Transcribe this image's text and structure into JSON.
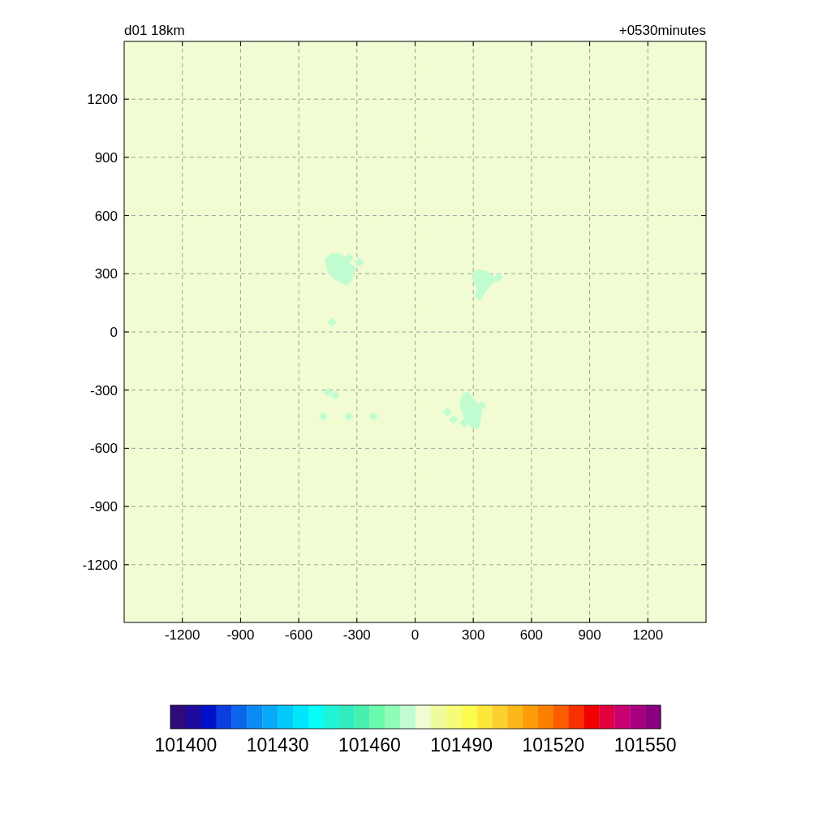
{
  "plot": {
    "title_left": "d01 18km",
    "title_right": "+0530minutes",
    "y_ticks": [
      "1200",
      "900",
      "600",
      "300",
      "0",
      "-300",
      "-600",
      "-900",
      "-1200"
    ],
    "x_ticks": [
      "-1200",
      "-900",
      "-600",
      "-300",
      "0",
      "300",
      "600",
      "900",
      "1200"
    ]
  },
  "colorbar": {
    "boxes": [
      {
        "color": "#2e0a7a"
      },
      {
        "color": "#1c0a9c"
      },
      {
        "color": "#0010c8"
      },
      {
        "color": "#0a3ee0"
      },
      {
        "color": "#0a66ea"
      },
      {
        "color": "#0a8cf4"
      },
      {
        "color": "#08aaf8"
      },
      {
        "color": "#04c8fa"
      },
      {
        "color": "#00e4fc"
      },
      {
        "color": "#08fcf8"
      },
      {
        "color": "#20f4d8"
      },
      {
        "color": "#30ecc0"
      },
      {
        "color": "#48f0b0"
      },
      {
        "color": "#68fcac"
      },
      {
        "color": "#90fcb8"
      },
      {
        "color": "#c0fcd0"
      },
      {
        "color": "#f2fcd2"
      },
      {
        "color": "#eefc9c"
      },
      {
        "color": "#f6fc78"
      },
      {
        "color": "#fcfc50"
      },
      {
        "color": "#fce838"
      },
      {
        "color": "#fcd030"
      },
      {
        "color": "#fcb818"
      },
      {
        "color": "#fc9c08"
      },
      {
        "color": "#fc8000"
      },
      {
        "color": "#fc5c00"
      },
      {
        "color": "#f83000"
      },
      {
        "color": "#f00000"
      },
      {
        "color": "#e00040"
      },
      {
        "color": "#c80070"
      },
      {
        "color": "#a80080"
      },
      {
        "color": "#880080"
      }
    ],
    "labels": [
      "101400",
      "101430",
      "101460",
      "101490",
      "101520",
      "101550"
    ]
  }
}
